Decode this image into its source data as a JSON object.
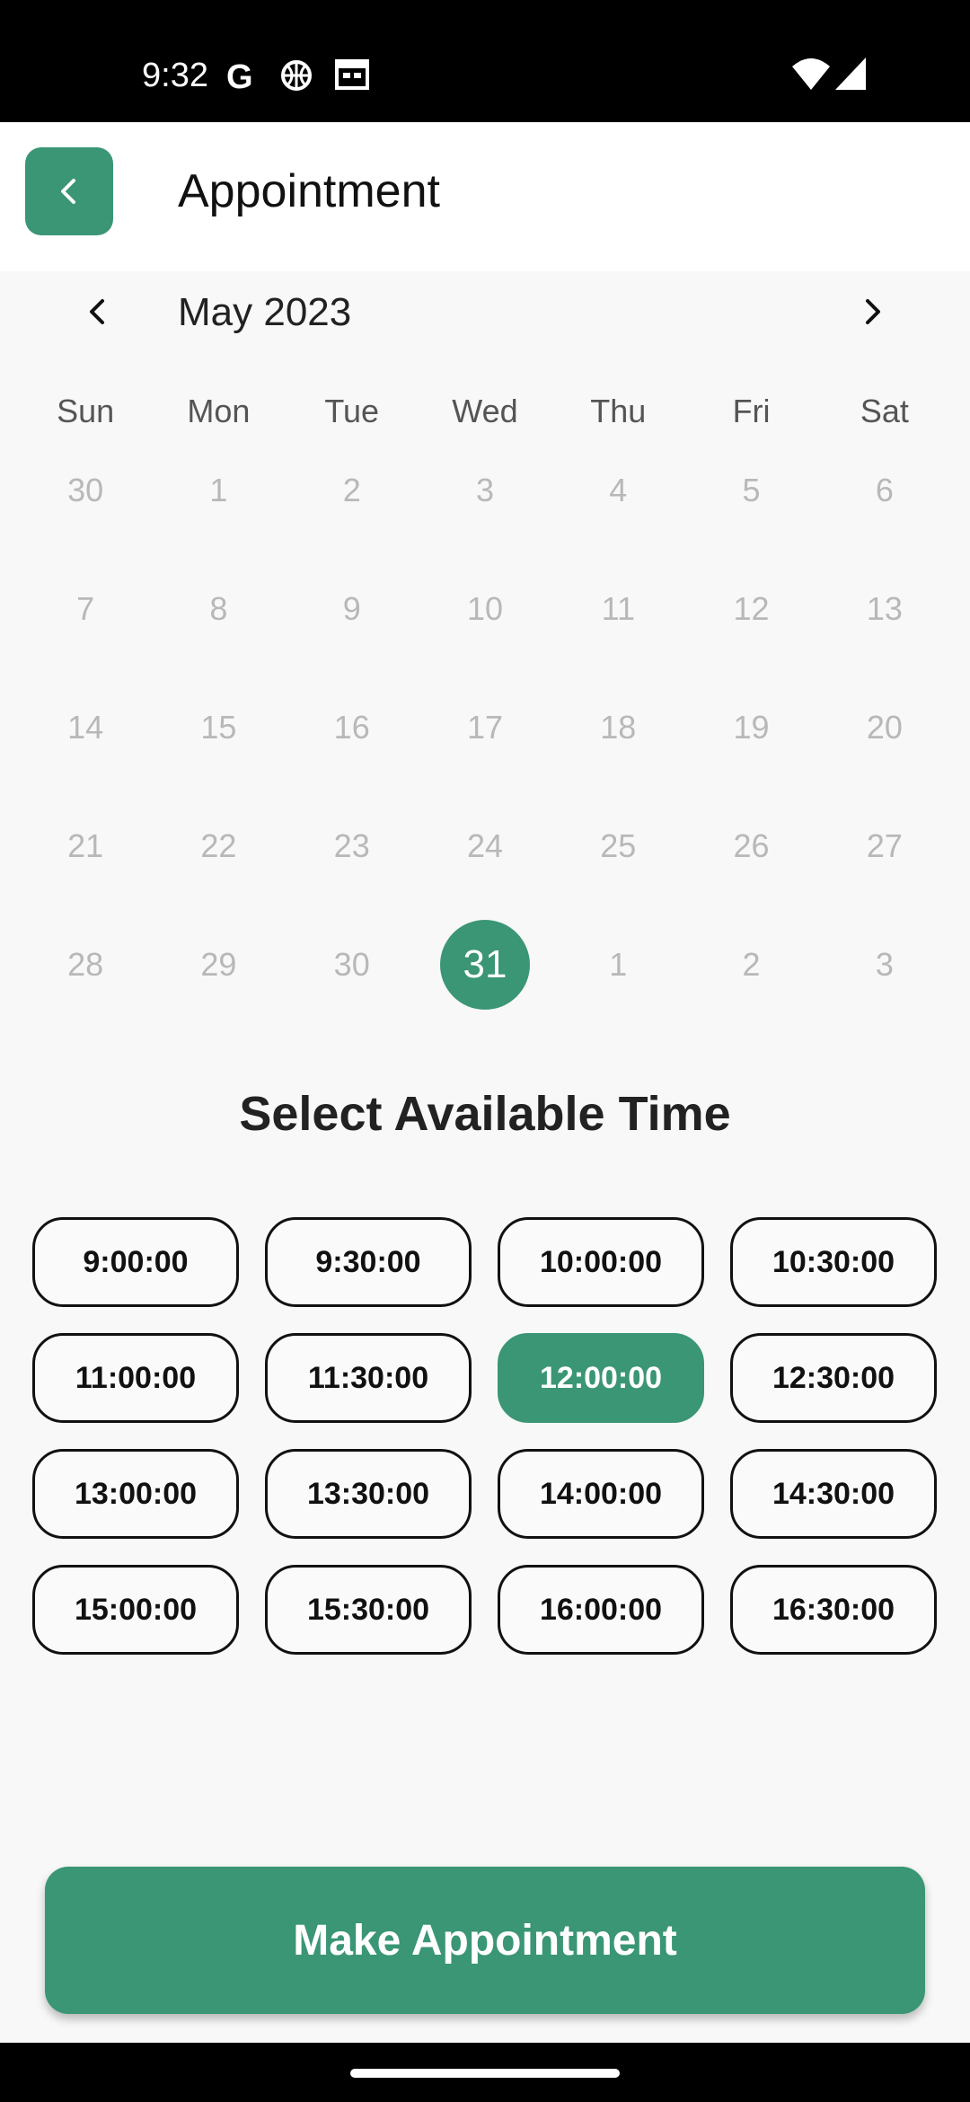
{
  "status_bar": {
    "time": "9:32",
    "icons_left": [
      "google-icon",
      "basketball-icon",
      "calendar-icon"
    ],
    "icons_right": [
      "wifi-icon",
      "signal-icon"
    ]
  },
  "app_bar": {
    "title": "Appointment",
    "back_icon": "chevron-left-icon"
  },
  "calendar": {
    "month": "May 2023",
    "weekdays": [
      "Sun",
      "Mon",
      "Tue",
      "Wed",
      "Thu",
      "Fri",
      "Sat"
    ],
    "weeks": [
      [
        "30",
        "1",
        "2",
        "3",
        "4",
        "5",
        "6"
      ],
      [
        "7",
        "8",
        "9",
        "10",
        "11",
        "12",
        "13"
      ],
      [
        "14",
        "15",
        "16",
        "17",
        "18",
        "19",
        "20"
      ],
      [
        "21",
        "22",
        "23",
        "24",
        "25",
        "26",
        "27"
      ],
      [
        "28",
        "29",
        "30",
        "31",
        "1",
        "2",
        "3"
      ]
    ],
    "selected_day": "31"
  },
  "time_section": {
    "title": "Select Available Time",
    "slots": [
      "9:00:00",
      "9:30:00",
      "10:00:00",
      "10:30:00",
      "11:00:00",
      "11:30:00",
      "12:00:00",
      "12:30:00",
      "13:00:00",
      "13:30:00",
      "14:00:00",
      "14:30:00",
      "15:00:00",
      "15:30:00",
      "16:00:00",
      "16:30:00"
    ],
    "selected_slot": "12:00:00"
  },
  "actions": {
    "make_appointment_label": "Make Appointment"
  },
  "colors": {
    "accent": "#3a9675",
    "muted_day": "#b8b8b8",
    "background": "#f8f8f8"
  }
}
